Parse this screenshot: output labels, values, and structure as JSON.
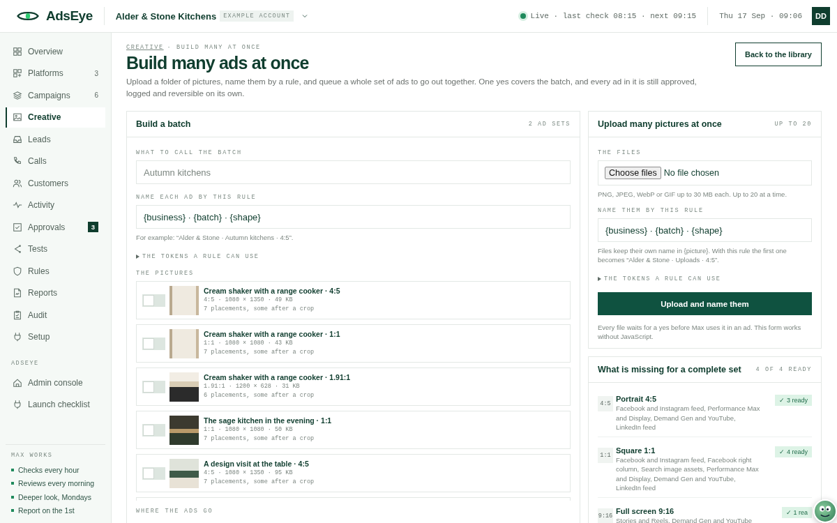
{
  "header": {
    "brand": "AdsEye",
    "account": "Alder & Stone Kitchens",
    "account_tag": "EXAMPLE ACCOUNT",
    "status": "Live · last check 08:15 · next 09:15",
    "datetime": "Thu 17 Sep · 09:06",
    "user_initials": "DD"
  },
  "sidebar": {
    "items": [
      {
        "label": "Overview",
        "selected": false
      },
      {
        "label": "Platforms",
        "selected": false,
        "count": "3"
      },
      {
        "label": "Campaigns",
        "selected": false,
        "count": "6"
      },
      {
        "label": "Creative",
        "selected": true
      },
      {
        "label": "Leads",
        "selected": false
      },
      {
        "label": "Calls",
        "selected": false
      },
      {
        "label": "Customers",
        "selected": false
      },
      {
        "label": "Activity",
        "selected": false
      },
      {
        "label": "Approvals",
        "selected": false,
        "badge": "3"
      },
      {
        "label": "Tests",
        "selected": false
      },
      {
        "label": "Rules",
        "selected": false
      },
      {
        "label": "Reports",
        "selected": false
      },
      {
        "label": "Audit",
        "selected": false
      },
      {
        "label": "Setup",
        "selected": false
      }
    ],
    "section_heading": "ADSEYE",
    "section_items": [
      {
        "label": "Admin console",
        "selected": false
      },
      {
        "label": "Launch checklist",
        "selected": false
      }
    ],
    "footer_heading": "MAX WORKS",
    "footer_items": [
      "Checks every hour",
      "Reviews every morning",
      "Deeper look, Mondays",
      "Report on the 1st"
    ]
  },
  "breadcrumb": {
    "link": "CREATIVE",
    "current": "· BUILD MANY AT ONCE"
  },
  "page": {
    "title": "Build many ads at once",
    "description": "Upload a folder of pictures, name them by a rule, and queue a whole set of ads to go out together. One yes covers the batch, and every ad in it is still approved, logged and reversible on its own.",
    "back_button": "Back to the library"
  },
  "batch": {
    "title": "Build a batch",
    "meta": "2 AD SETS",
    "name_label": "WHAT TO CALL THE BATCH",
    "name_placeholder": "Autumn kitchens",
    "rule_label": "NAME EACH AD BY THIS RULE",
    "rule_value": "{business} · {batch} · {shape}",
    "rule_hint": "For example: “Alder & Stone · Autumn kitchens · 4:5”.",
    "tokens": {
      "label": "THE TOKENS A RULE CAN USE",
      "expanded": false
    },
    "pictures_label": "THE PICTURES",
    "pictures": [
      {
        "title": "Cream shaker with a range cooker · 4:5",
        "specs": "4:5 · 1080 × 1350 · 49 KB",
        "note": "7 placements, some after a crop",
        "on": false
      },
      {
        "title": "Cream shaker with a range cooker · 1:1",
        "specs": "1:1 · 1080 × 1080 · 43 KB",
        "note": "7 placements, some after a crop",
        "on": false
      },
      {
        "title": "Cream shaker with a range cooker · 1.91:1",
        "specs": "1.91:1 · 1200 × 628 · 31 KB",
        "note": "6 placements, some after a crop",
        "on": false
      },
      {
        "title": "The sage kitchen in the evening · 1:1",
        "specs": "1:1 · 1080 × 1080 · 50 KB",
        "note": "7 placements, some after a crop",
        "on": false
      },
      {
        "title": "A design visit at the table · 4:5",
        "specs": "4:5 · 1080 × 1350 · 95 KB",
        "note": "7 placements, some after a crop",
        "on": false
      }
    ],
    "where_label": "WHERE THE ADS GO"
  },
  "upload": {
    "title": "Upload many pictures at once",
    "meta": "UP TO 20",
    "files_label": "THE FILES",
    "choose_button": "Choose files",
    "no_file": "No file chosen",
    "files_hint": "PNG, JPEG, WebP or GIF up to 30 MB each. Up to 20 at a time.",
    "rule_label": "NAME THEM BY THIS RULE",
    "rule_value": "{business} · {batch} · {shape}",
    "rule_hint": "Files keep their own name in {picture}. With this rule the first one becomes “Alder & Stone · Uploads · 4:5”.",
    "tokens": {
      "label": "THE TOKENS A RULE CAN USE",
      "expanded": false
    },
    "submit_button": "Upload and name them",
    "footnote": "Every file waits for a yes before Max uses it in an ad. This form works without JavaScript."
  },
  "sets": {
    "title": "What is missing for a complete set",
    "meta": "4 OF 4 READY",
    "items": [
      {
        "code": "4:5",
        "title": "Portrait 4:5",
        "placements": "Facebook and Instagram feed, Performance Max and Display, Demand Gen and YouTube, LinkedIn feed",
        "status": "✓ 3 ready"
      },
      {
        "code": "1:1",
        "title": "Square 1:1",
        "placements": "Facebook and Instagram feed, Facebook right column, Search image assets, Performance Max and Display, Demand Gen and YouTube, LinkedIn feed",
        "status": "✓ 4 ready"
      },
      {
        "code": "9:16",
        "title": "Full screen 9:16",
        "placements": "Stories and Reels, Demand Gen and YouTube",
        "status": "✓ 1 rea"
      }
    ]
  }
}
